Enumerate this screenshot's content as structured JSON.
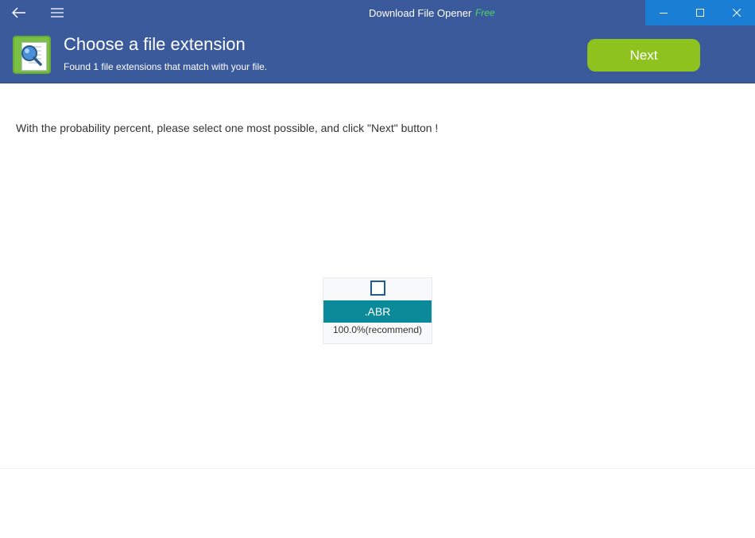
{
  "titlebar": {
    "app_name": "Download File Opener",
    "edition": "Free",
    "accent_color": "#1a7fd4"
  },
  "header": {
    "title": "Choose a file extension",
    "subtitle": "Found 1 file extensions that match with your file.",
    "next_label": "Next",
    "background_color": "#3b5a9b",
    "next_color": "#8dc21f"
  },
  "main": {
    "instruction": "With the probability percent, please select one most possible, and click \"Next\" button !",
    "extensions": [
      {
        "name": ".ABR",
        "probability": "100.0%(recommend)",
        "checked": false,
        "color": "#0b8a9a"
      }
    ]
  },
  "icons": {
    "back": "back-arrow-icon",
    "menu": "hamburger-menu-icon",
    "minimize": "minimize-icon",
    "maximize": "maximize-icon",
    "close": "close-icon",
    "logo": "magnifier-document-icon"
  }
}
